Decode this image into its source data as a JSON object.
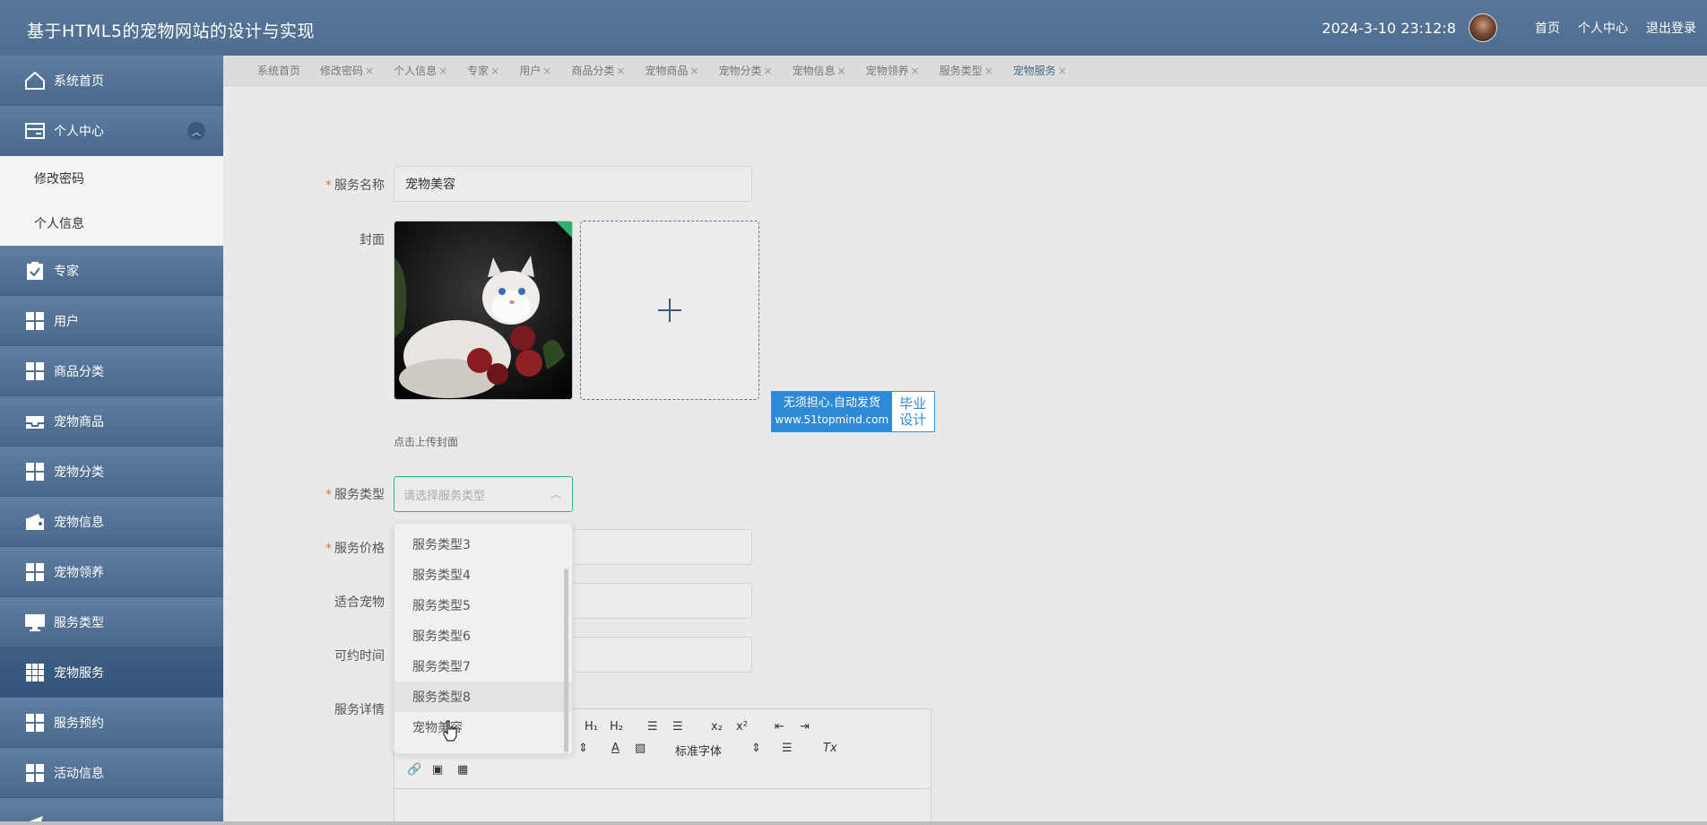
{
  "header": {
    "title": "基于HTML5的宠物网站的设计与实现",
    "datetime": "2024-3-10 23:12:8",
    "links": [
      "首页",
      "个人中心",
      "退出登录"
    ]
  },
  "sidebar": {
    "items": [
      {
        "label": "系统首页",
        "icon": "home-icon"
      },
      {
        "label": "个人中心",
        "icon": "card-icon",
        "expanded": true
      },
      {
        "label": "修改密码",
        "sub": true
      },
      {
        "label": "个人信息",
        "sub": true
      },
      {
        "label": "专家",
        "icon": "clipboard-icon"
      },
      {
        "label": "用户",
        "icon": "grid-icon"
      },
      {
        "label": "商品分类",
        "icon": "grid-icon"
      },
      {
        "label": "宠物商品",
        "icon": "inbox-icon"
      },
      {
        "label": "宠物分类",
        "icon": "grid-icon"
      },
      {
        "label": "宠物信息",
        "icon": "wallet-icon"
      },
      {
        "label": "宠物领养",
        "icon": "grid-icon"
      },
      {
        "label": "服务类型",
        "icon": "monitor-icon"
      },
      {
        "label": "宠物服务",
        "icon": "grid9-icon",
        "active": true
      },
      {
        "label": "服务预约",
        "icon": "grid-icon"
      },
      {
        "label": "活动信息",
        "icon": "grid-icon"
      }
    ]
  },
  "tabs": [
    "系统首页",
    "修改密码",
    "个人信息",
    "专家",
    "用户",
    "商品分类",
    "宠物商品",
    "宠物分类",
    "宠物信息",
    "宠物领养",
    "服务类型",
    "宠物服务"
  ],
  "form": {
    "name_label": "服务名称",
    "name_value": "宠物美容",
    "cover_label": "封面",
    "cover_tip": "点击上传封面",
    "type_label": "服务类型",
    "type_placeholder": "请选择服务类型",
    "price_label": "服务价格",
    "suitable_label": "适合宠物",
    "time_label": "可约时间",
    "detail_label": "服务详情"
  },
  "dropdown": {
    "options": [
      "服务类型3",
      "服务类型4",
      "服务类型5",
      "服务类型6",
      "服务类型7",
      "服务类型8",
      "宠物美容"
    ],
    "hovered_index": 5
  },
  "editor": {
    "font_label": "标准字体"
  },
  "badge": {
    "line1": "无须担心.自动发货",
    "line2": "www.51topmind.com",
    "right1": "毕业",
    "right2": "设计"
  },
  "colors": {
    "header_bg": "#587799",
    "sidebar_bg": "#48688c",
    "select_focus": "#2cb57c",
    "required": "#e8713a"
  }
}
